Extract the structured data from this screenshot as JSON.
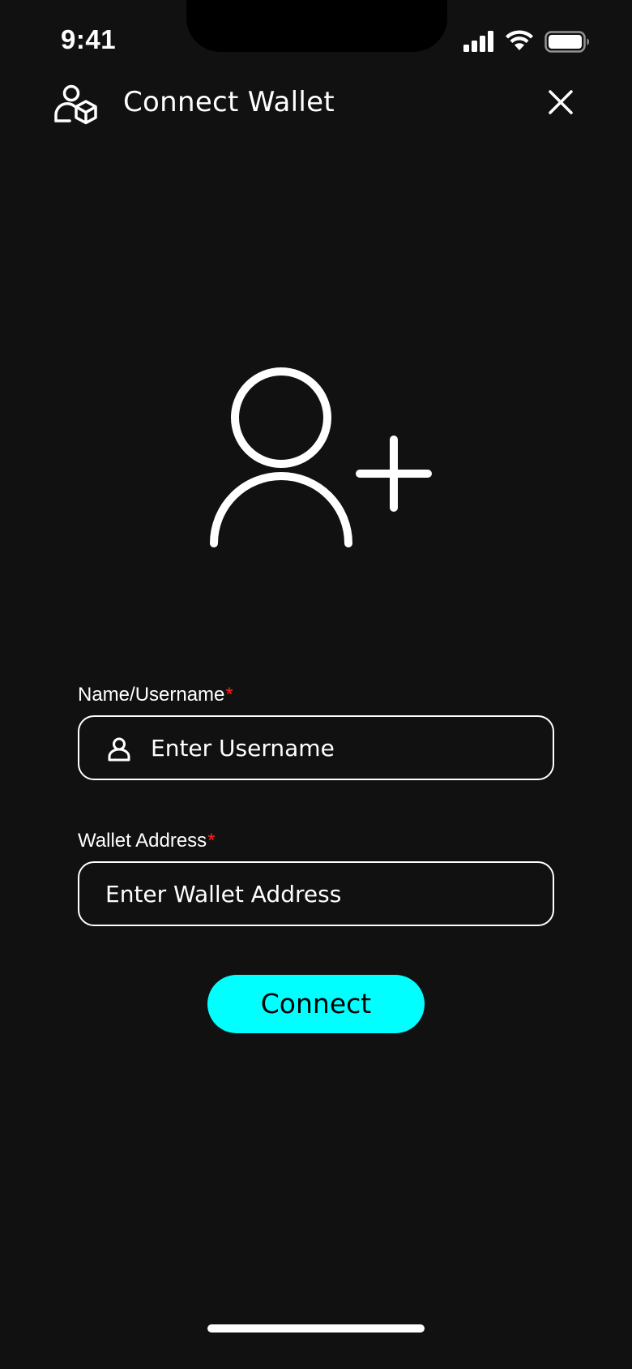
{
  "status_bar": {
    "time": "9:41"
  },
  "header": {
    "title": "Connect Wallet",
    "icon": "user-wallet-icon",
    "close_icon": "close-icon"
  },
  "hero": {
    "icon": "user-add-icon"
  },
  "form": {
    "username": {
      "label": "Name/Username",
      "required_mark": "*",
      "placeholder": "Enter Username",
      "value": "",
      "icon": "user-icon"
    },
    "wallet_address": {
      "label": "Wallet Address",
      "required_mark": "*",
      "placeholder": "Enter Wallet Address",
      "value": ""
    },
    "submit_label": "Connect"
  },
  "colors": {
    "background": "#111111",
    "accent": "#00ffff",
    "required": "#ff2020",
    "text": "#ffffff"
  }
}
